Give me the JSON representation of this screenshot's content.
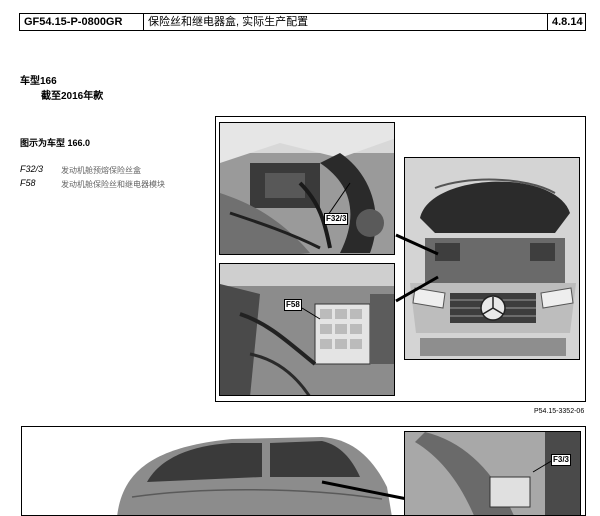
{
  "header": {
    "doc_id": "GF54.15-P-0800GR",
    "title": "保险丝和继电器盒, 实际生产配置",
    "section": "4.8.14"
  },
  "model": {
    "line1": "车型166",
    "line2": "截至2016年款"
  },
  "figure": {
    "caption": "图示为车型 166.0",
    "legend": [
      {
        "code": "F32/3",
        "desc": "发动机舱预熔保险丝盒"
      },
      {
        "code": "F58",
        "desc": "发动机舱保险丝和继电器模块"
      }
    ],
    "callouts": [
      "F32/3",
      "F58"
    ],
    "ref": "P54.15-3352-06"
  },
  "figure2": {
    "callouts": [
      "F3/3"
    ]
  }
}
